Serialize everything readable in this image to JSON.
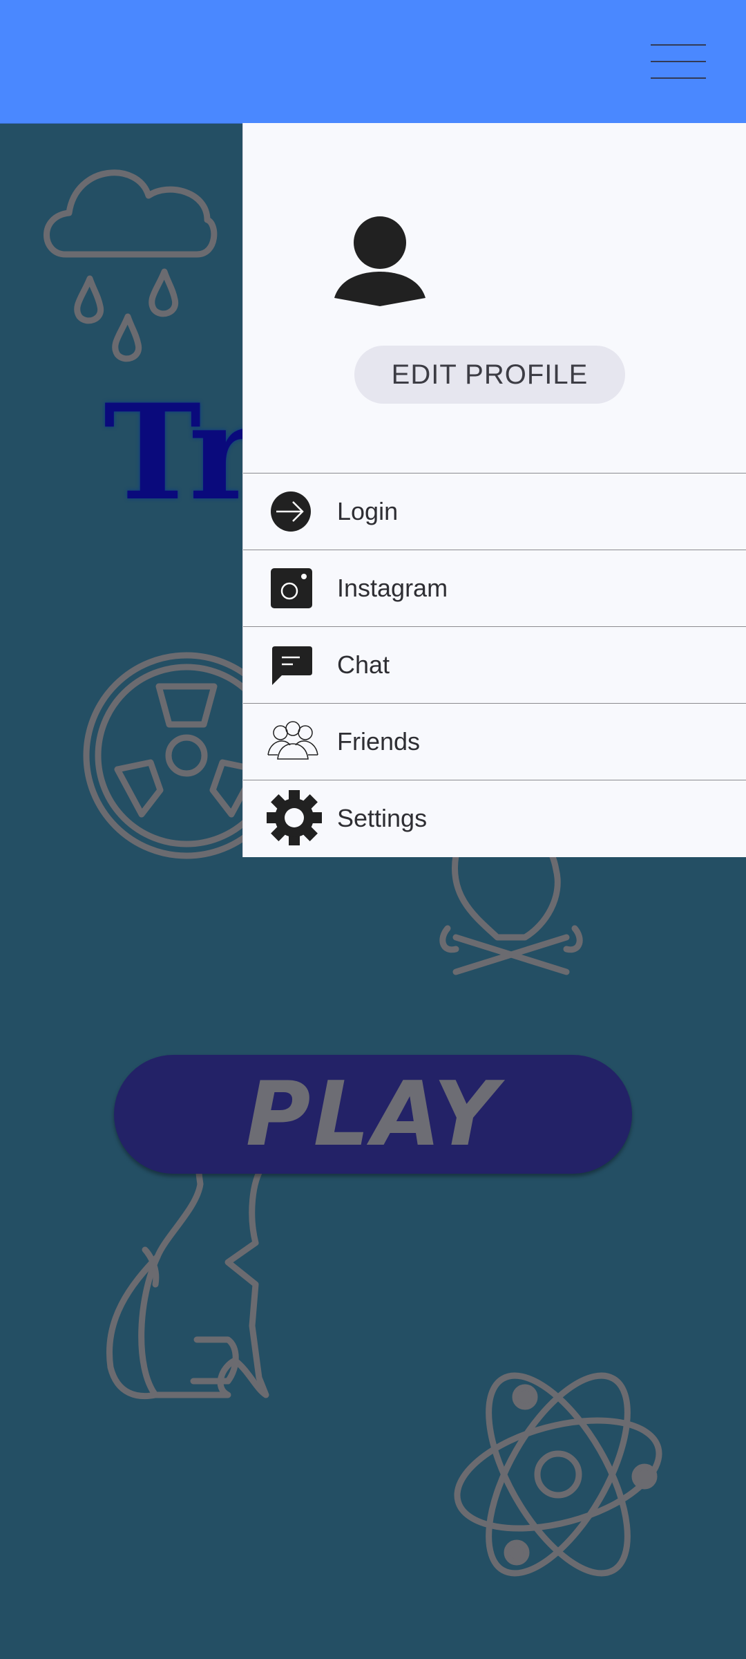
{
  "header": {
    "menu_icon": "hamburger-icon",
    "bar_color": "#4a88ff"
  },
  "background": {
    "color": "#244f64",
    "title_text": "Tr",
    "doodle_icons": [
      "rain-cloud-icon",
      "radiation-icon",
      "campfire-icon",
      "cat-icon",
      "atom-icon"
    ]
  },
  "play_button": {
    "label": "PLAY"
  },
  "drawer": {
    "avatar_icon": "user-avatar-icon",
    "edit_profile_label": "EDIT PROFILE",
    "items": [
      {
        "label": "Login",
        "icon": "login-arrow-icon"
      },
      {
        "label": "Instagram",
        "icon": "instagram-icon"
      },
      {
        "label": "Chat",
        "icon": "chat-bubble-icon"
      },
      {
        "label": "Friends",
        "icon": "friends-group-icon"
      },
      {
        "label": "Settings",
        "icon": "gear-icon"
      }
    ]
  }
}
